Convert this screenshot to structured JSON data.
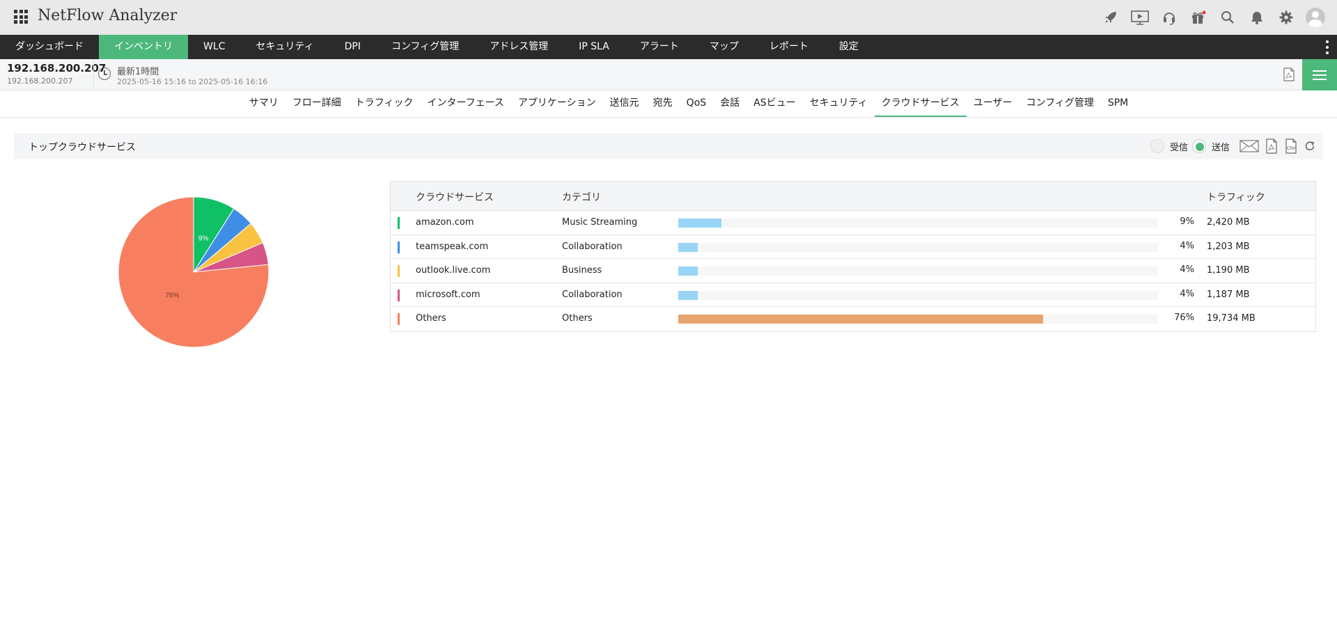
{
  "app": {
    "title": "NetFlow Analyzer"
  },
  "top_icons": [
    "rocket-icon",
    "presentation-icon",
    "headset-icon",
    "gift-icon",
    "search-icon",
    "bell-icon",
    "gear-icon",
    "user-avatar"
  ],
  "main_nav": {
    "items": [
      {
        "label": "ダッシュボード",
        "active": false
      },
      {
        "label": "インベントリ",
        "active": true
      },
      {
        "label": "WLC",
        "active": false
      },
      {
        "label": "セキュリティ",
        "active": false
      },
      {
        "label": "DPI",
        "active": false
      },
      {
        "label": "コンフィグ管理",
        "active": false
      },
      {
        "label": "アドレス管理",
        "active": false
      },
      {
        "label": "IP SLA",
        "active": false
      },
      {
        "label": "アラート",
        "active": false
      },
      {
        "label": "マップ",
        "active": false
      },
      {
        "label": "レポート",
        "active": false
      },
      {
        "label": "設定",
        "active": false
      }
    ]
  },
  "device": {
    "ip": "192.168.200.207",
    "ip_sub": "192.168.200.207",
    "period_label": "最新1時間",
    "period_range": "2025-05-16 15:16 to 2025-05-16 16:16"
  },
  "sub_tabs": {
    "items": [
      {
        "label": "サマリ",
        "active": false
      },
      {
        "label": "フロー詳細",
        "active": false
      },
      {
        "label": "トラフィック",
        "active": false
      },
      {
        "label": "インターフェース",
        "active": false
      },
      {
        "label": "アプリケーション",
        "active": false
      },
      {
        "label": "送信元",
        "active": false
      },
      {
        "label": "宛先",
        "active": false
      },
      {
        "label": "QoS",
        "active": false
      },
      {
        "label": "会話",
        "active": false
      },
      {
        "label": "ASビュー",
        "active": false
      },
      {
        "label": "セキュリティ",
        "active": false
      },
      {
        "label": "クラウドサービス",
        "active": true
      },
      {
        "label": "ユーザー",
        "active": false
      },
      {
        "label": "コンフィグ管理",
        "active": false
      },
      {
        "label": "SPM",
        "active": false
      }
    ]
  },
  "widget": {
    "title": "トップクラウドサービス",
    "receive_label": "受信",
    "send_label": "送信",
    "receive_selected": false,
    "send_selected": true,
    "accent_color": "#4db87c"
  },
  "table": {
    "headers": {
      "service": "クラウドサービス",
      "category": "カテゴリ",
      "traffic": "トラフィック"
    },
    "rows": [
      {
        "service": "amazon.com",
        "category": "Music Streaming",
        "percent_label": "9%",
        "share": 0.09,
        "traffic": "2,420 MB",
        "color": "#10c065",
        "bar_color": "#97d4f5"
      },
      {
        "service": "teamspeak.com",
        "category": "Collaboration",
        "percent_label": "4%",
        "share": 0.04,
        "traffic": "1,203 MB",
        "color": "#3f8ee6",
        "bar_color": "#97d4f5"
      },
      {
        "service": "outlook.live.com",
        "category": "Business",
        "percent_label": "4%",
        "share": 0.04,
        "traffic": "1,190 MB",
        "color": "#f9c241",
        "bar_color": "#97d4f5"
      },
      {
        "service": "microsoft.com",
        "category": "Collaboration",
        "percent_label": "4%",
        "share": 0.04,
        "traffic": "1,187 MB",
        "color": "#d65586",
        "bar_color": "#97d4f5"
      },
      {
        "service": "Others",
        "category": "Others",
        "percent_label": "76%",
        "share": 0.76,
        "traffic": "19,734 MB",
        "color": "#f77f5f",
        "bar_color": "#e8a46e"
      }
    ]
  },
  "chart_data": {
    "type": "pie",
    "slices": [
      {
        "label": "amazon.com",
        "value": 9,
        "color": "#10c065",
        "data_label": "9%"
      },
      {
        "label": "teamspeak.com",
        "value": 4.8,
        "color": "#3f8ee6",
        "data_label": ""
      },
      {
        "label": "outlook.live.com",
        "value": 4.8,
        "color": "#f9c241",
        "data_label": ""
      },
      {
        "label": "microsoft.com",
        "value": 4.8,
        "color": "#d65586",
        "data_label": ""
      },
      {
        "label": "Others",
        "value": 76.6,
        "color": "#f77f5f",
        "data_label": "76%"
      }
    ]
  }
}
